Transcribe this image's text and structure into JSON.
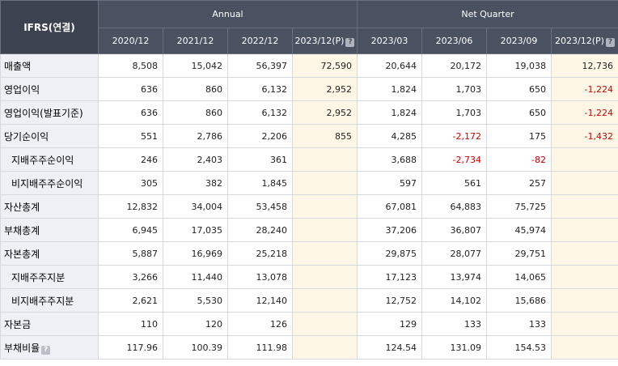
{
  "header": {
    "corner": "IFRS(연결)",
    "annual_label": "Annual",
    "quarter_label": "Net Quarter",
    "columns": [
      "2020/12",
      "2021/12",
      "2022/12",
      "2023/12(P)",
      "2023/03",
      "2023/06",
      "2023/09",
      "2023/12(P)"
    ],
    "help_icon": "?"
  },
  "rows": [
    {
      "label": "매출액",
      "values": [
        "8,508",
        "15,042",
        "56,397",
        "72,590",
        "20,644",
        "20,172",
        "19,038",
        "12,736"
      ]
    },
    {
      "label": "영업이익",
      "values": [
        "636",
        "860",
        "6,132",
        "2,952",
        "1,824",
        "1,703",
        "650",
        "-1,224"
      ]
    },
    {
      "label": "영업이익(발표기준)",
      "values": [
        "636",
        "860",
        "6,132",
        "2,952",
        "1,824",
        "1,703",
        "650",
        "-1,224"
      ]
    },
    {
      "label": "당기순이익",
      "values": [
        "551",
        "2,786",
        "2,206",
        "855",
        "4,285",
        "-2,172",
        "175",
        "-1,432"
      ]
    },
    {
      "label": "지배주주순이익",
      "values": [
        "246",
        "2,403",
        "361",
        "",
        "3,688",
        "-2,734",
        "-82",
        ""
      ]
    },
    {
      "label": "비지배주주순이익",
      "values": [
        "305",
        "382",
        "1,845",
        "",
        "597",
        "561",
        "257",
        ""
      ]
    },
    {
      "label": "자산총계",
      "values": [
        "12,832",
        "34,004",
        "53,458",
        "",
        "67,081",
        "64,883",
        "75,725",
        ""
      ]
    },
    {
      "label": "부채총계",
      "values": [
        "6,945",
        "17,035",
        "28,240",
        "",
        "37,206",
        "36,807",
        "45,974",
        ""
      ]
    },
    {
      "label": "자본총계",
      "values": [
        "5,887",
        "16,969",
        "25,218",
        "",
        "29,875",
        "28,077",
        "29,751",
        ""
      ]
    },
    {
      "label": "지배주주지분",
      "values": [
        "3,266",
        "11,440",
        "13,078",
        "",
        "17,123",
        "13,974",
        "14,065",
        ""
      ]
    },
    {
      "label": "비지배주주지분",
      "values": [
        "2,621",
        "5,530",
        "12,140",
        "",
        "12,752",
        "14,102",
        "15,686",
        ""
      ]
    },
    {
      "label": "자본금",
      "values": [
        "110",
        "120",
        "126",
        "",
        "129",
        "133",
        "133",
        ""
      ]
    },
    {
      "label": "부채비율",
      "values": [
        "117.96",
        "100.39",
        "111.98",
        "",
        "124.54",
        "131.09",
        "154.53",
        ""
      ]
    }
  ]
}
